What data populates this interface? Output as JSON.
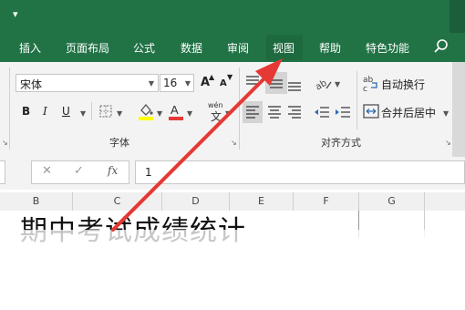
{
  "quick_access": {
    "dropdown": "▾"
  },
  "tabs": [
    {
      "label": "插入"
    },
    {
      "label": "页面布局"
    },
    {
      "label": "公式"
    },
    {
      "label": "数据"
    },
    {
      "label": "审阅"
    },
    {
      "label": "视图"
    },
    {
      "label": "帮助"
    },
    {
      "label": "特色功能"
    }
  ],
  "font_group": {
    "font_name": "宋体",
    "font_size": "16",
    "grow": "A",
    "shrink": "A",
    "bold": "B",
    "italic": "I",
    "underline": "U",
    "label": "字体"
  },
  "align_group": {
    "wrap_text": "自动换行",
    "merge_center": "合并后居中",
    "label": "对齐方式"
  },
  "formula_bar": {
    "fx": "fx",
    "value": "1"
  },
  "columns": [
    "B",
    "C",
    "D",
    "E",
    "F",
    "G"
  ],
  "sheet": {
    "title_text": "期中考试成绩统计"
  },
  "colors": {
    "excel_green": "#217346",
    "annotation_red": "#e53935"
  }
}
